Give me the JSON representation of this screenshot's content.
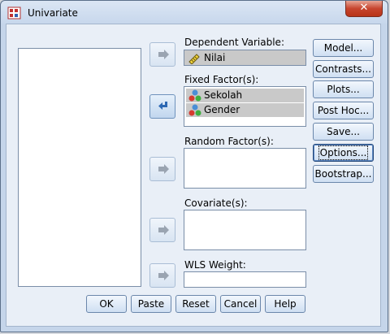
{
  "window": {
    "title": "Univariate",
    "close_label": "✕"
  },
  "source_list": {
    "items": []
  },
  "dependent": {
    "label": "Dependent Variable:",
    "value": "Nilai"
  },
  "fixed": {
    "label": "Fixed Factor(s):",
    "items": [
      "Sekolah",
      "Gender"
    ]
  },
  "random": {
    "label": "Random Factor(s):"
  },
  "covariate": {
    "label": "Covariate(s):"
  },
  "wls": {
    "label": "WLS Weight:"
  },
  "side_buttons": {
    "model": "Model...",
    "contrasts": "Contrasts...",
    "plots": "Plots...",
    "posthoc": "Post Hoc...",
    "save": "Save...",
    "options": "Options...",
    "bootstrap": "Bootstrap..."
  },
  "bottom_buttons": {
    "ok": "OK",
    "paste": "Paste",
    "reset": "Reset",
    "cancel": "Cancel",
    "help": "Help"
  },
  "icons": {
    "arrow": "arrow-right-icon",
    "arrow_back": "arrow-back-icon",
    "scale": "ruler-scale-icon",
    "nominal": "nominal-variable-icon"
  },
  "colors": {
    "accent": "#6e92bc",
    "close": "#c7452e",
    "selection": "#c9c9c9"
  }
}
